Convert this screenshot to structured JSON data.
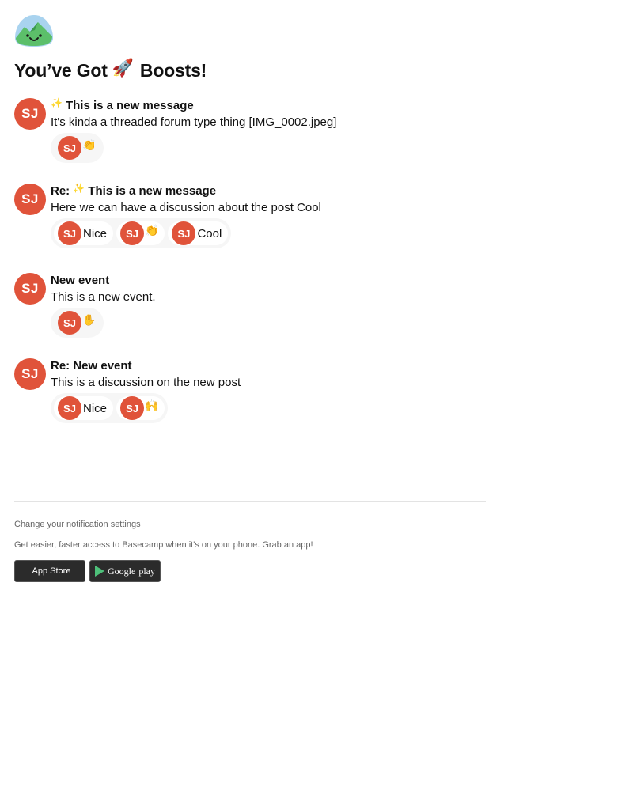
{
  "header": {
    "logo": "basecamp-logo",
    "title_before": "You’ve Got",
    "title_emoji": "🚀",
    "title_after": "Boosts!"
  },
  "items": [
    {
      "avatar": "SJ",
      "subject_prefix": "",
      "subject_emoji": "✨",
      "subject": "This is a new message",
      "excerpt": "It's kinda a threaded forum type thing [IMG_0002.jpeg]",
      "boosts": [
        {
          "avatar": "SJ",
          "content": "👏",
          "kind": "emoji"
        }
      ]
    },
    {
      "avatar": "SJ",
      "subject_prefix": "Re:",
      "subject_emoji": "✨",
      "subject": "This is a new message",
      "excerpt": "Here we can have a discussion about the post Cool",
      "boosts": [
        {
          "avatar": "SJ",
          "content": "Nice",
          "kind": "text"
        },
        {
          "avatar": "SJ",
          "content": "👏",
          "kind": "emoji"
        },
        {
          "avatar": "SJ",
          "content": "Cool",
          "kind": "text"
        }
      ]
    },
    {
      "avatar": "SJ",
      "subject_prefix": "",
      "subject_emoji": "",
      "subject": "New event",
      "excerpt": "This is a new event.",
      "boosts": [
        {
          "avatar": "SJ",
          "content": "✋",
          "kind": "emoji"
        }
      ]
    },
    {
      "avatar": "SJ",
      "subject_prefix": "Re:",
      "subject_emoji": "",
      "subject": "New event",
      "excerpt": "This is a discussion on the new post",
      "boosts": [
        {
          "avatar": "SJ",
          "content": "Nice",
          "kind": "text"
        },
        {
          "avatar": "SJ",
          "content": "🙌",
          "kind": "emoji"
        }
      ]
    }
  ],
  "footer": {
    "settings_link": "Change your notification settings",
    "app_note": "Get easier, faster access to Basecamp when it's on your phone. Grab an app!",
    "app_store": "App Store",
    "google_play_a": "Google",
    "google_play_b": "play"
  },
  "colors": {
    "avatar": "#e0533a",
    "boost_bg": "#f6f6f6",
    "divider": "#e3e3e3"
  }
}
